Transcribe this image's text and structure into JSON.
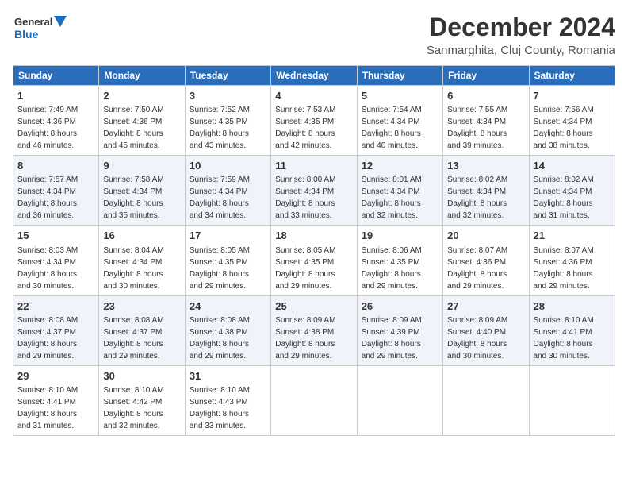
{
  "header": {
    "logo_line1": "General",
    "logo_line2": "Blue",
    "month_title": "December 2024",
    "location": "Sanmarghita, Cluj County, Romania"
  },
  "weekdays": [
    "Sunday",
    "Monday",
    "Tuesday",
    "Wednesday",
    "Thursday",
    "Friday",
    "Saturday"
  ],
  "weeks": [
    [
      {
        "day": "1",
        "info": "Sunrise: 7:49 AM\nSunset: 4:36 PM\nDaylight: 8 hours\nand 46 minutes."
      },
      {
        "day": "2",
        "info": "Sunrise: 7:50 AM\nSunset: 4:36 PM\nDaylight: 8 hours\nand 45 minutes."
      },
      {
        "day": "3",
        "info": "Sunrise: 7:52 AM\nSunset: 4:35 PM\nDaylight: 8 hours\nand 43 minutes."
      },
      {
        "day": "4",
        "info": "Sunrise: 7:53 AM\nSunset: 4:35 PM\nDaylight: 8 hours\nand 42 minutes."
      },
      {
        "day": "5",
        "info": "Sunrise: 7:54 AM\nSunset: 4:34 PM\nDaylight: 8 hours\nand 40 minutes."
      },
      {
        "day": "6",
        "info": "Sunrise: 7:55 AM\nSunset: 4:34 PM\nDaylight: 8 hours\nand 39 minutes."
      },
      {
        "day": "7",
        "info": "Sunrise: 7:56 AM\nSunset: 4:34 PM\nDaylight: 8 hours\nand 38 minutes."
      }
    ],
    [
      {
        "day": "8",
        "info": "Sunrise: 7:57 AM\nSunset: 4:34 PM\nDaylight: 8 hours\nand 36 minutes."
      },
      {
        "day": "9",
        "info": "Sunrise: 7:58 AM\nSunset: 4:34 PM\nDaylight: 8 hours\nand 35 minutes."
      },
      {
        "day": "10",
        "info": "Sunrise: 7:59 AM\nSunset: 4:34 PM\nDaylight: 8 hours\nand 34 minutes."
      },
      {
        "day": "11",
        "info": "Sunrise: 8:00 AM\nSunset: 4:34 PM\nDaylight: 8 hours\nand 33 minutes."
      },
      {
        "day": "12",
        "info": "Sunrise: 8:01 AM\nSunset: 4:34 PM\nDaylight: 8 hours\nand 32 minutes."
      },
      {
        "day": "13",
        "info": "Sunrise: 8:02 AM\nSunset: 4:34 PM\nDaylight: 8 hours\nand 32 minutes."
      },
      {
        "day": "14",
        "info": "Sunrise: 8:02 AM\nSunset: 4:34 PM\nDaylight: 8 hours\nand 31 minutes."
      }
    ],
    [
      {
        "day": "15",
        "info": "Sunrise: 8:03 AM\nSunset: 4:34 PM\nDaylight: 8 hours\nand 30 minutes."
      },
      {
        "day": "16",
        "info": "Sunrise: 8:04 AM\nSunset: 4:34 PM\nDaylight: 8 hours\nand 30 minutes."
      },
      {
        "day": "17",
        "info": "Sunrise: 8:05 AM\nSunset: 4:35 PM\nDaylight: 8 hours\nand 29 minutes."
      },
      {
        "day": "18",
        "info": "Sunrise: 8:05 AM\nSunset: 4:35 PM\nDaylight: 8 hours\nand 29 minutes."
      },
      {
        "day": "19",
        "info": "Sunrise: 8:06 AM\nSunset: 4:35 PM\nDaylight: 8 hours\nand 29 minutes."
      },
      {
        "day": "20",
        "info": "Sunrise: 8:07 AM\nSunset: 4:36 PM\nDaylight: 8 hours\nand 29 minutes."
      },
      {
        "day": "21",
        "info": "Sunrise: 8:07 AM\nSunset: 4:36 PM\nDaylight: 8 hours\nand 29 minutes."
      }
    ],
    [
      {
        "day": "22",
        "info": "Sunrise: 8:08 AM\nSunset: 4:37 PM\nDaylight: 8 hours\nand 29 minutes."
      },
      {
        "day": "23",
        "info": "Sunrise: 8:08 AM\nSunset: 4:37 PM\nDaylight: 8 hours\nand 29 minutes."
      },
      {
        "day": "24",
        "info": "Sunrise: 8:08 AM\nSunset: 4:38 PM\nDaylight: 8 hours\nand 29 minutes."
      },
      {
        "day": "25",
        "info": "Sunrise: 8:09 AM\nSunset: 4:38 PM\nDaylight: 8 hours\nand 29 minutes."
      },
      {
        "day": "26",
        "info": "Sunrise: 8:09 AM\nSunset: 4:39 PM\nDaylight: 8 hours\nand 29 minutes."
      },
      {
        "day": "27",
        "info": "Sunrise: 8:09 AM\nSunset: 4:40 PM\nDaylight: 8 hours\nand 30 minutes."
      },
      {
        "day": "28",
        "info": "Sunrise: 8:10 AM\nSunset: 4:41 PM\nDaylight: 8 hours\nand 30 minutes."
      }
    ],
    [
      {
        "day": "29",
        "info": "Sunrise: 8:10 AM\nSunset: 4:41 PM\nDaylight: 8 hours\nand 31 minutes."
      },
      {
        "day": "30",
        "info": "Sunrise: 8:10 AM\nSunset: 4:42 PM\nDaylight: 8 hours\nand 32 minutes."
      },
      {
        "day": "31",
        "info": "Sunrise: 8:10 AM\nSunset: 4:43 PM\nDaylight: 8 hours\nand 33 minutes."
      },
      null,
      null,
      null,
      null
    ]
  ]
}
